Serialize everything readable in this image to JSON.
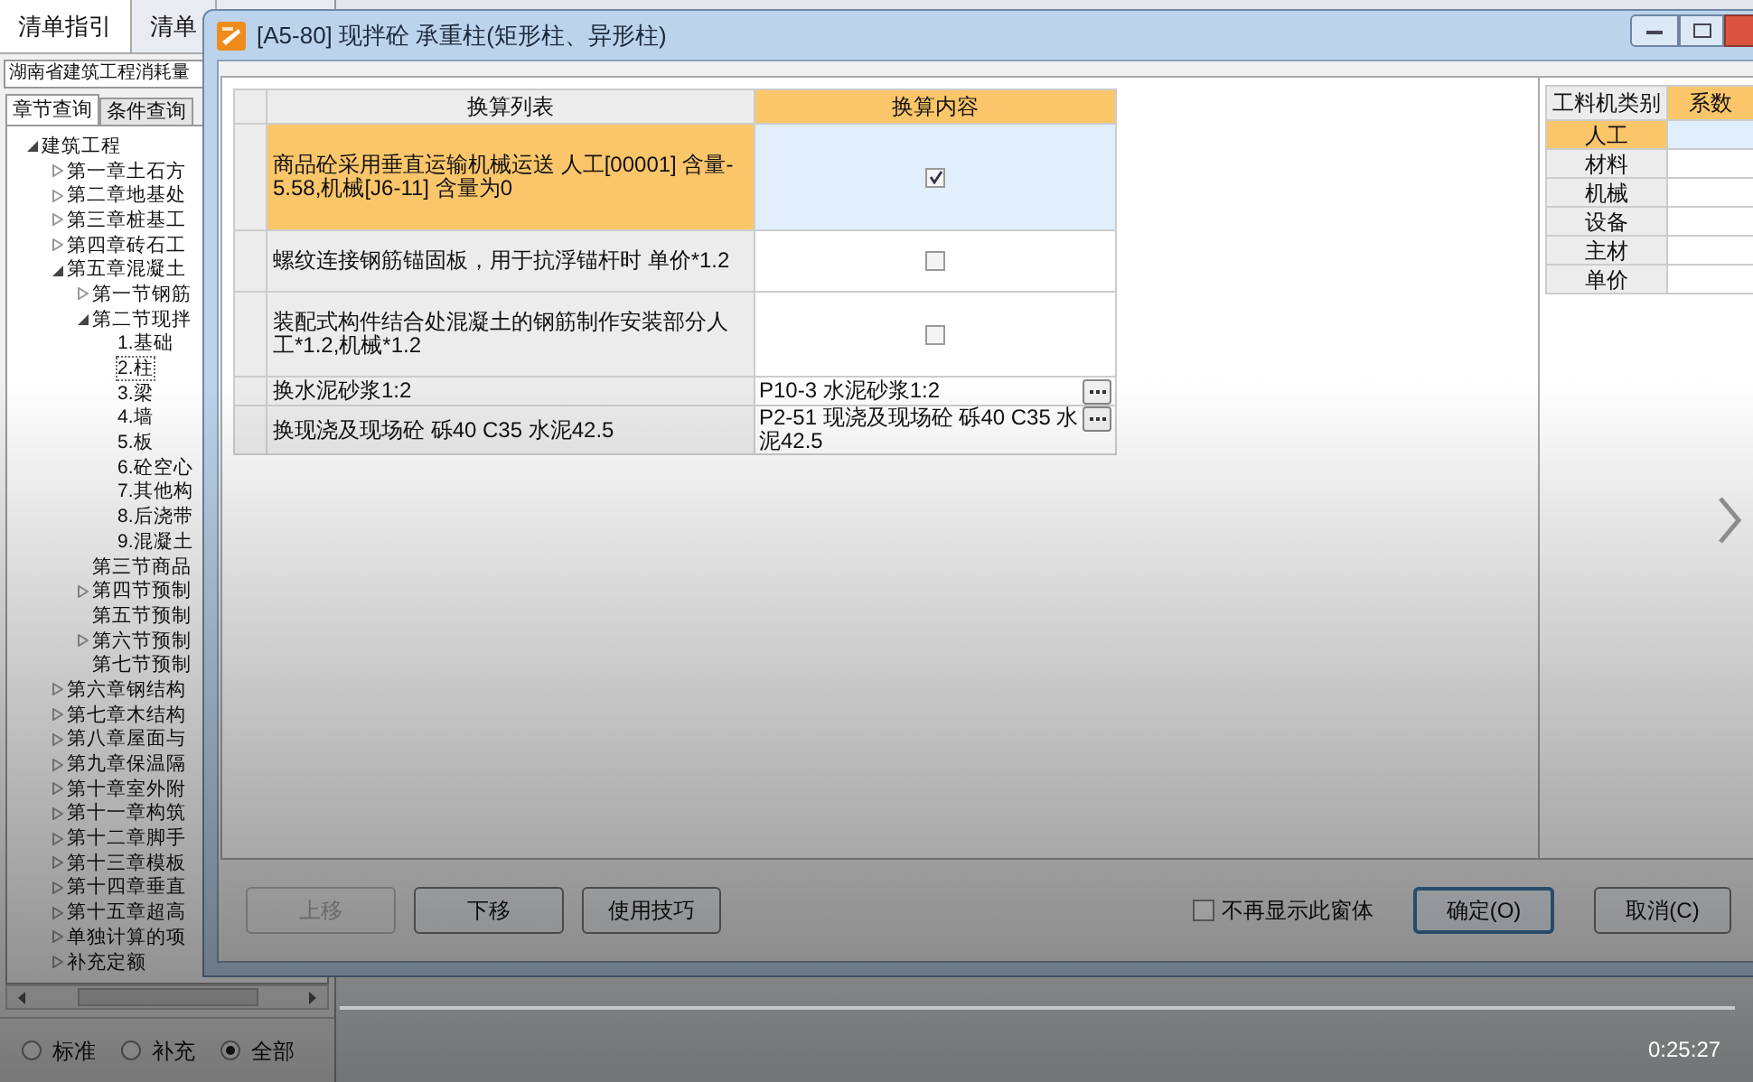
{
  "app": {
    "tabs": [
      {
        "label": "清单指引",
        "selected": true
      },
      {
        "label": "清单",
        "selected": false
      }
    ],
    "library": "湖南省建筑工程消耗量",
    "query_tabs": [
      {
        "label": "章节查询",
        "selected": true
      },
      {
        "label": "条件查询",
        "selected": false
      }
    ],
    "tree": [
      {
        "label": "建筑工程",
        "expanded": true,
        "selected": false,
        "children": [
          {
            "label": "第一章土石方",
            "expanded": false,
            "selected": false
          },
          {
            "label": "第二章地基处",
            "expanded": false,
            "selected": false
          },
          {
            "label": "第三章桩基工",
            "expanded": false,
            "selected": false
          },
          {
            "label": "第四章砖石工",
            "expanded": false,
            "selected": false
          },
          {
            "label": "第五章混凝土",
            "expanded": true,
            "selected": false,
            "children": [
              {
                "label": "第一节钢筋",
                "expanded": false,
                "selected": false
              },
              {
                "label": "第二节现拌",
                "expanded": true,
                "selected": false,
                "children": [
                  {
                    "label": "1.基础",
                    "selected": false
                  },
                  {
                    "label": "2.柱",
                    "selected": true
                  },
                  {
                    "label": "3.梁",
                    "selected": false
                  },
                  {
                    "label": "4.墙",
                    "selected": false
                  },
                  {
                    "label": "5.板",
                    "selected": false
                  },
                  {
                    "label": "6.砼空心",
                    "selected": false
                  },
                  {
                    "label": "7.其他构",
                    "selected": false
                  },
                  {
                    "label": "8.后浇带",
                    "selected": false
                  },
                  {
                    "label": "9.混凝土",
                    "selected": false
                  }
                ]
              },
              {
                "label": "第三节商品",
                "selected": false
              },
              {
                "label": "第四节预制",
                "expanded": false,
                "selected": false
              },
              {
                "label": "第五节预制",
                "selected": false
              },
              {
                "label": "第六节预制",
                "expanded": false,
                "selected": false
              },
              {
                "label": "第七节预制",
                "selected": false
              }
            ]
          },
          {
            "label": "第六章钢结构",
            "expanded": false,
            "selected": false
          },
          {
            "label": "第七章木结构",
            "expanded": false,
            "selected": false
          },
          {
            "label": "第八章屋面与",
            "expanded": false,
            "selected": false
          },
          {
            "label": "第九章保温隔",
            "expanded": false,
            "selected": false
          },
          {
            "label": "第十章室外附",
            "expanded": false,
            "selected": false
          },
          {
            "label": "第十一章构筑",
            "expanded": false,
            "selected": false
          },
          {
            "label": "第十二章脚手",
            "expanded": false,
            "selected": false
          },
          {
            "label": "第十三章模板",
            "expanded": false,
            "selected": false
          },
          {
            "label": "第十四章垂直",
            "expanded": false,
            "selected": false
          },
          {
            "label": "第十五章超高",
            "expanded": false,
            "selected": false
          },
          {
            "label": "单独计算的项",
            "expanded": false,
            "selected": false
          },
          {
            "label": "补充定额",
            "expanded": false,
            "selected": false
          }
        ]
      }
    ],
    "filters": [
      {
        "label": "标准",
        "selected": false
      },
      {
        "label": "补充",
        "selected": false
      },
      {
        "label": "全部",
        "selected": true
      }
    ]
  },
  "dialog": {
    "title": "[A5-80]  现拌砼 承重柱(矩形柱、异形柱)",
    "table": {
      "columns": [
        "换算列表",
        "换算内容"
      ],
      "rows": [
        {
          "kind": "checkbox",
          "label": "商品砼采用垂直运输机械运送 人工[00001] 含量-5.58,机械[J6-11] 含量为0",
          "checked": true,
          "selected": true
        },
        {
          "kind": "checkbox",
          "label": "螺纹连接钢筋锚固板，用于抗浮锚杆时 单价*1.2",
          "checked": false,
          "selected": false
        },
        {
          "kind": "checkbox",
          "label": "装配式构件结合处混凝土的钢筋制作安装部分人工*1.2,机械*1.2",
          "checked": false,
          "selected": false
        },
        {
          "kind": "lookup",
          "label": "换水泥砂浆1:2",
          "value": "P10-3  水泥砂浆1:2",
          "selected": false
        },
        {
          "kind": "lookup",
          "label": "换现浇及现场砼 砾40 C35 水泥42.5",
          "value": "P2-51  现浇及现场砼 砾40 C35 水泥42.5",
          "selected": false
        }
      ]
    },
    "coefficients": {
      "columns": [
        "工料机类别",
        "系数"
      ],
      "rows": [
        {
          "label": "人工",
          "selected": true
        },
        {
          "label": "材料",
          "selected": false
        },
        {
          "label": "机械",
          "selected": false
        },
        {
          "label": "设备",
          "selected": false
        },
        {
          "label": "主材",
          "selected": false
        },
        {
          "label": "单价",
          "selected": false
        }
      ]
    },
    "buttons": [
      {
        "label": "上移",
        "disabled": true
      },
      {
        "label": "下移",
        "disabled": false
      },
      {
        "label": "使用技巧",
        "disabled": false
      }
    ],
    "dont_show": {
      "label": "不再显示此窗体",
      "checked": false
    },
    "ok": "确定(O)",
    "cancel": "取消(C)"
  },
  "video": {
    "time": "0:25:27"
  }
}
